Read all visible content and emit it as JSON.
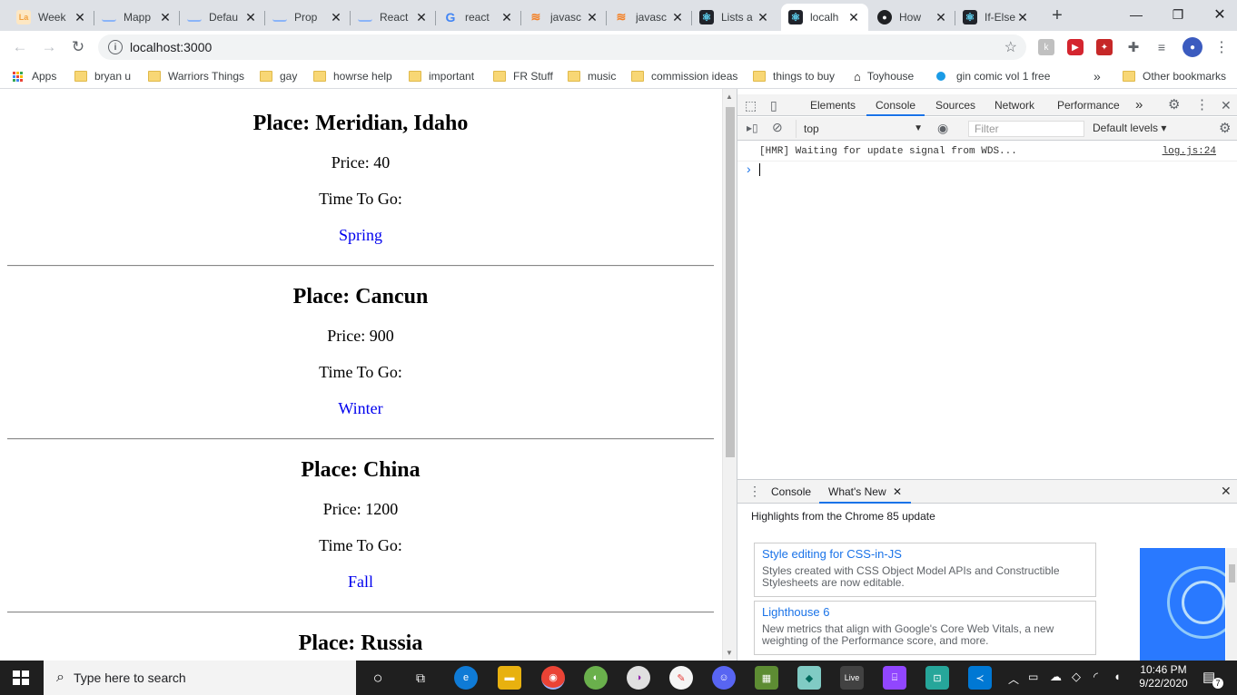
{
  "browser": {
    "tabs": [
      {
        "title": "Week",
        "favicon": "lab-icon",
        "color": "#f2a03d"
      },
      {
        "title": "Mapp",
        "favicon": "page-icon",
        "color": "#8ab4f8"
      },
      {
        "title": "Defau",
        "favicon": "page-icon",
        "color": "#8ab4f8"
      },
      {
        "title": "Prop",
        "favicon": "page-icon",
        "color": "#8ab4f8"
      },
      {
        "title": "React",
        "favicon": "page-icon",
        "color": "#8ab4f8"
      },
      {
        "title": "react",
        "favicon": "google-icon",
        "color": "#4285f4"
      },
      {
        "title": "javasc",
        "favicon": "stackoverflow-icon",
        "color": "#f48024"
      },
      {
        "title": "javasc",
        "favicon": "stackoverflow-icon",
        "color": "#f48024"
      },
      {
        "title": "Lists a",
        "favicon": "react-icon",
        "color": "#61dafb"
      },
      {
        "title": "localh",
        "favicon": "react-icon",
        "color": "#61dafb"
      },
      {
        "title": "How",
        "favicon": "github-icon",
        "color": "#202124"
      },
      {
        "title": "If-Else",
        "favicon": "react-icon",
        "color": "#61dafb"
      }
    ],
    "address": "localhost:3000",
    "bookmarks": [
      {
        "label": "Apps"
      },
      {
        "label": "bryan u"
      },
      {
        "label": "Warriors Things"
      },
      {
        "label": "gay"
      },
      {
        "label": "howrse help"
      },
      {
        "label": "important"
      },
      {
        "label": "FR Stuff"
      },
      {
        "label": "music"
      },
      {
        "label": "commission ideas"
      },
      {
        "label": "things to buy"
      },
      {
        "label": "Toyhouse"
      },
      {
        "label": "gin comic vol 1 free"
      },
      {
        "label": "Other bookmarks"
      }
    ],
    "overflow": "»"
  },
  "page": {
    "places": [
      {
        "place": "Place: Meridian, Idaho",
        "price": "Price: 40",
        "time_label": "Time To Go:",
        "season": "Spring"
      },
      {
        "place": "Place: Cancun",
        "price": "Price: 900",
        "time_label": "Time To Go:",
        "season": "Winter"
      },
      {
        "place": "Place: China",
        "price": "Price: 1200",
        "time_label": "Time To Go:",
        "season": "Fall"
      },
      {
        "place": "Place: Russia"
      }
    ]
  },
  "devtools": {
    "tabs": [
      "Elements",
      "Console",
      "Sources",
      "Network",
      "Performance"
    ],
    "more": "»",
    "context": "top",
    "filter_placeholder": "Filter",
    "levels": "Default levels ▾",
    "log_message": "[HMR] Waiting for update signal from WDS...",
    "log_source": "log.js:24",
    "prompt": "›",
    "drawer_tabs": [
      "Console",
      "What's New"
    ],
    "drawer_heading": "Highlights from the Chrome 85 update",
    "highlights": [
      {
        "title": "Style editing for CSS-in-JS",
        "desc": "Styles created with CSS Object Model APIs and Constructible Stylesheets are now editable."
      },
      {
        "title": "Lighthouse 6",
        "desc": "New metrics that align with Google's Core Web Vitals, a new weighting of the Performance score, and more."
      }
    ]
  },
  "taskbar": {
    "search_placeholder": "Type here to search",
    "time": "10:46 PM",
    "date": "9/22/2020",
    "notification_count": "7",
    "live_label": "Live"
  }
}
